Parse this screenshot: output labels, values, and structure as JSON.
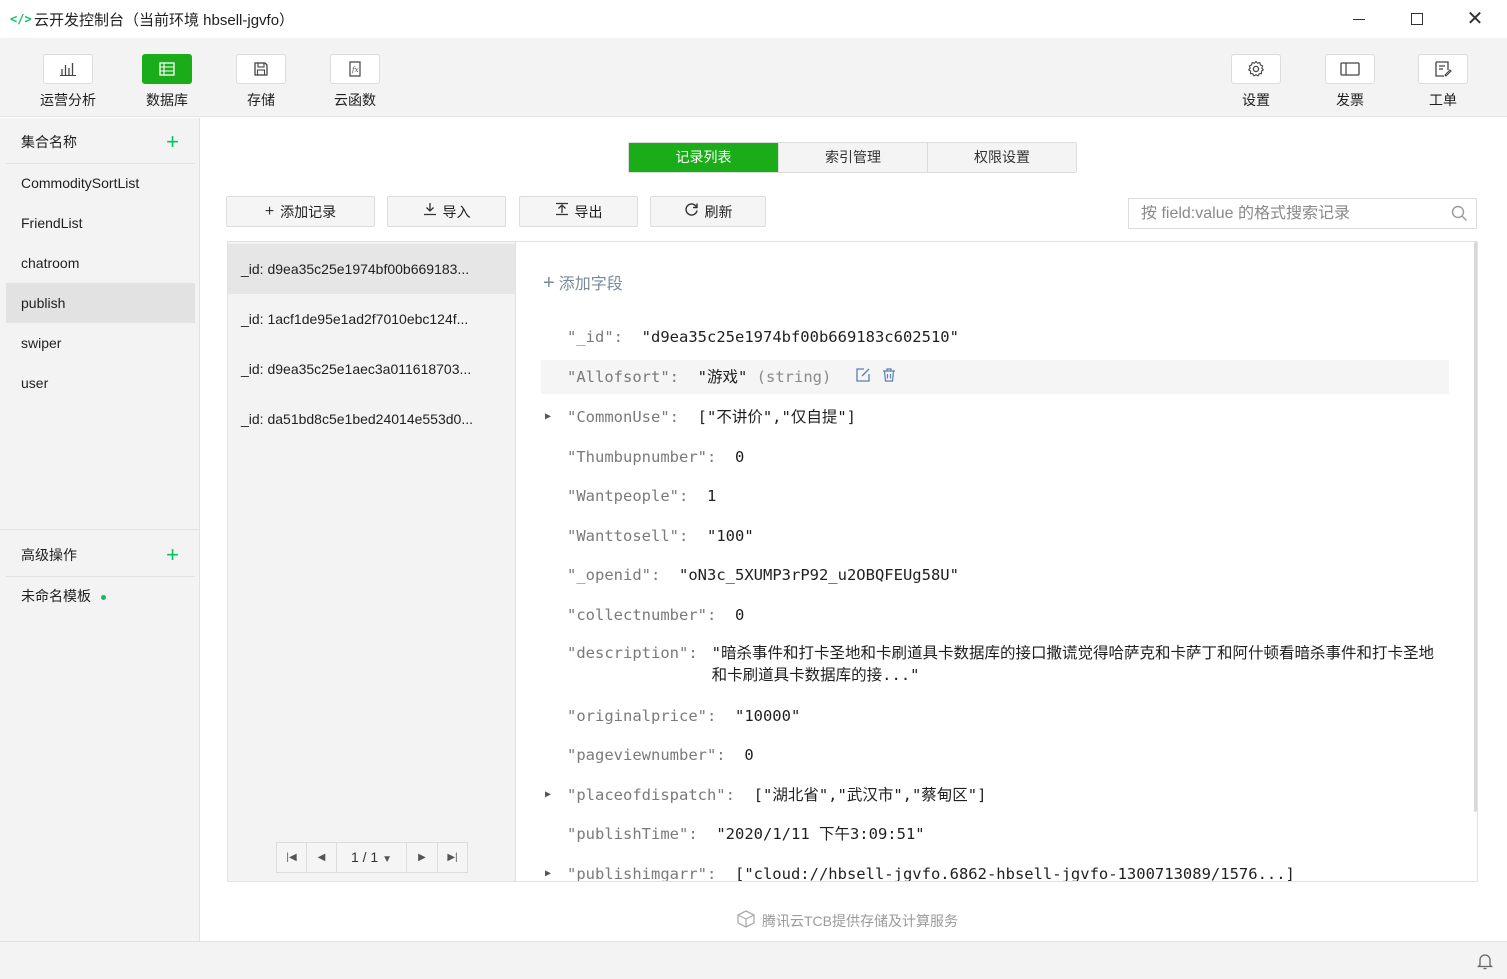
{
  "window": {
    "title": "云开发控制台（当前环境 hbsell-jgvfo）",
    "logo": "</>"
  },
  "toolbar": {
    "left": [
      {
        "label": "运营分析",
        "icon": "bar-chart-icon",
        "active": false
      },
      {
        "label": "数据库",
        "icon": "database-icon",
        "active": true
      },
      {
        "label": "存储",
        "icon": "storage-icon",
        "active": false
      },
      {
        "label": "云函数",
        "icon": "function-icon",
        "active": false
      }
    ],
    "right": [
      {
        "label": "设置",
        "icon": "gear-icon"
      },
      {
        "label": "发票",
        "icon": "invoice-icon"
      },
      {
        "label": "工单",
        "icon": "ticket-icon"
      }
    ]
  },
  "sidebar": {
    "collections_header": "集合名称",
    "collections": [
      "CommoditySortList",
      "FriendList",
      "chatroom",
      "publish",
      "swiper",
      "user"
    ],
    "selected": "publish",
    "advanced_header": "高级操作",
    "template": "未命名模板"
  },
  "tabs": [
    "记录列表",
    "索引管理",
    "权限设置"
  ],
  "actions": {
    "add": "添加记录",
    "import": "导入",
    "export": "导出",
    "refresh": "刷新"
  },
  "search": {
    "placeholder": "按 field:value 的格式搜索记录"
  },
  "records": [
    "_id: d9ea35c25e1974bf00b669183...",
    "_id: 1acf1de95e1ad2f7010ebc124f...",
    "_id: d9ea35c25e1aec3a011618703...",
    "_id: da51bd8c5e1bed24014e553d0..."
  ],
  "pager": {
    "page": "1 / 1"
  },
  "detail": {
    "add_field": "添加字段",
    "fields": [
      {
        "key": "\"_id\":",
        "value": "\"d9ea35c25e1974bf00b669183c602510\""
      },
      {
        "key": "\"Allofsort\":",
        "value": "\"游戏\"",
        "type": "(string)"
      },
      {
        "key": "\"CommonUse\":",
        "value": "[\"不讲价\",\"仅自提\"]"
      },
      {
        "key": "\"Thumbupnumber\":",
        "value": "0"
      },
      {
        "key": "\"Wantpeople\":",
        "value": "1"
      },
      {
        "key": "\"Wanttosell\":",
        "value": "\"100\""
      },
      {
        "key": "\"_openid\":",
        "value": "\"oN3c_5XUMP3rP92_u2OBQFEUg58U\""
      },
      {
        "key": "\"collectnumber\":",
        "value": "0"
      },
      {
        "key": "\"description\":",
        "value": "\"暗杀事件和打卡圣地和卡刷道具卡数据库的接口撒谎觉得哈萨克和卡萨丁和阿什顿看暗杀事件和打卡圣地和卡刷道具卡数据库的接...\""
      },
      {
        "key": "\"originalprice\":",
        "value": "\"10000\""
      },
      {
        "key": "\"pageviewnumber\":",
        "value": "0"
      },
      {
        "key": "\"placeofdispatch\":",
        "value": "[\"湖北省\",\"武汉市\",\"蔡甸区\"]"
      },
      {
        "key": "\"publishTime\":",
        "value": "\"2020/1/11 下午3:09:51\""
      },
      {
        "key": "\"publishimgarr\":",
        "value": "[\"cloud://hbsell-jgvfo.6862-hbsell-jgvfo-1300713089/1576...]"
      }
    ]
  },
  "footer": {
    "text": "腾讯云TCB提供存储及计算服务"
  },
  "colors": {
    "accent": "#1aad19",
    "plus": "#07c160"
  }
}
